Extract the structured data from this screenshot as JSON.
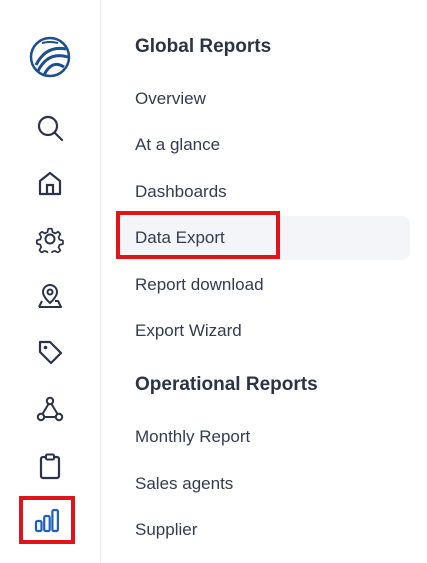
{
  "colors": {
    "icon": "#2a3347",
    "active_icon": "#1f5fbf",
    "highlight": "#e0151b",
    "selected_bg": "#f3f5f8"
  },
  "rail": {
    "icons": [
      {
        "name": "search-icon"
      },
      {
        "name": "home-icon"
      },
      {
        "name": "settings-gear-icon"
      },
      {
        "name": "location-person-icon"
      },
      {
        "name": "tag-icon"
      },
      {
        "name": "network-nodes-icon"
      },
      {
        "name": "clipboard-icon"
      },
      {
        "name": "bar-chart-icon",
        "active": true
      }
    ]
  },
  "menu": {
    "global": {
      "title": "Global Reports",
      "items": [
        "Overview",
        "At a glance",
        "Dashboards",
        "Data Export",
        "Report download",
        "Export Wizard"
      ]
    },
    "operational": {
      "title": "Operational Reports",
      "items": [
        "Monthly Report",
        "Sales agents",
        "Supplier"
      ]
    },
    "selected": "Data Export"
  }
}
